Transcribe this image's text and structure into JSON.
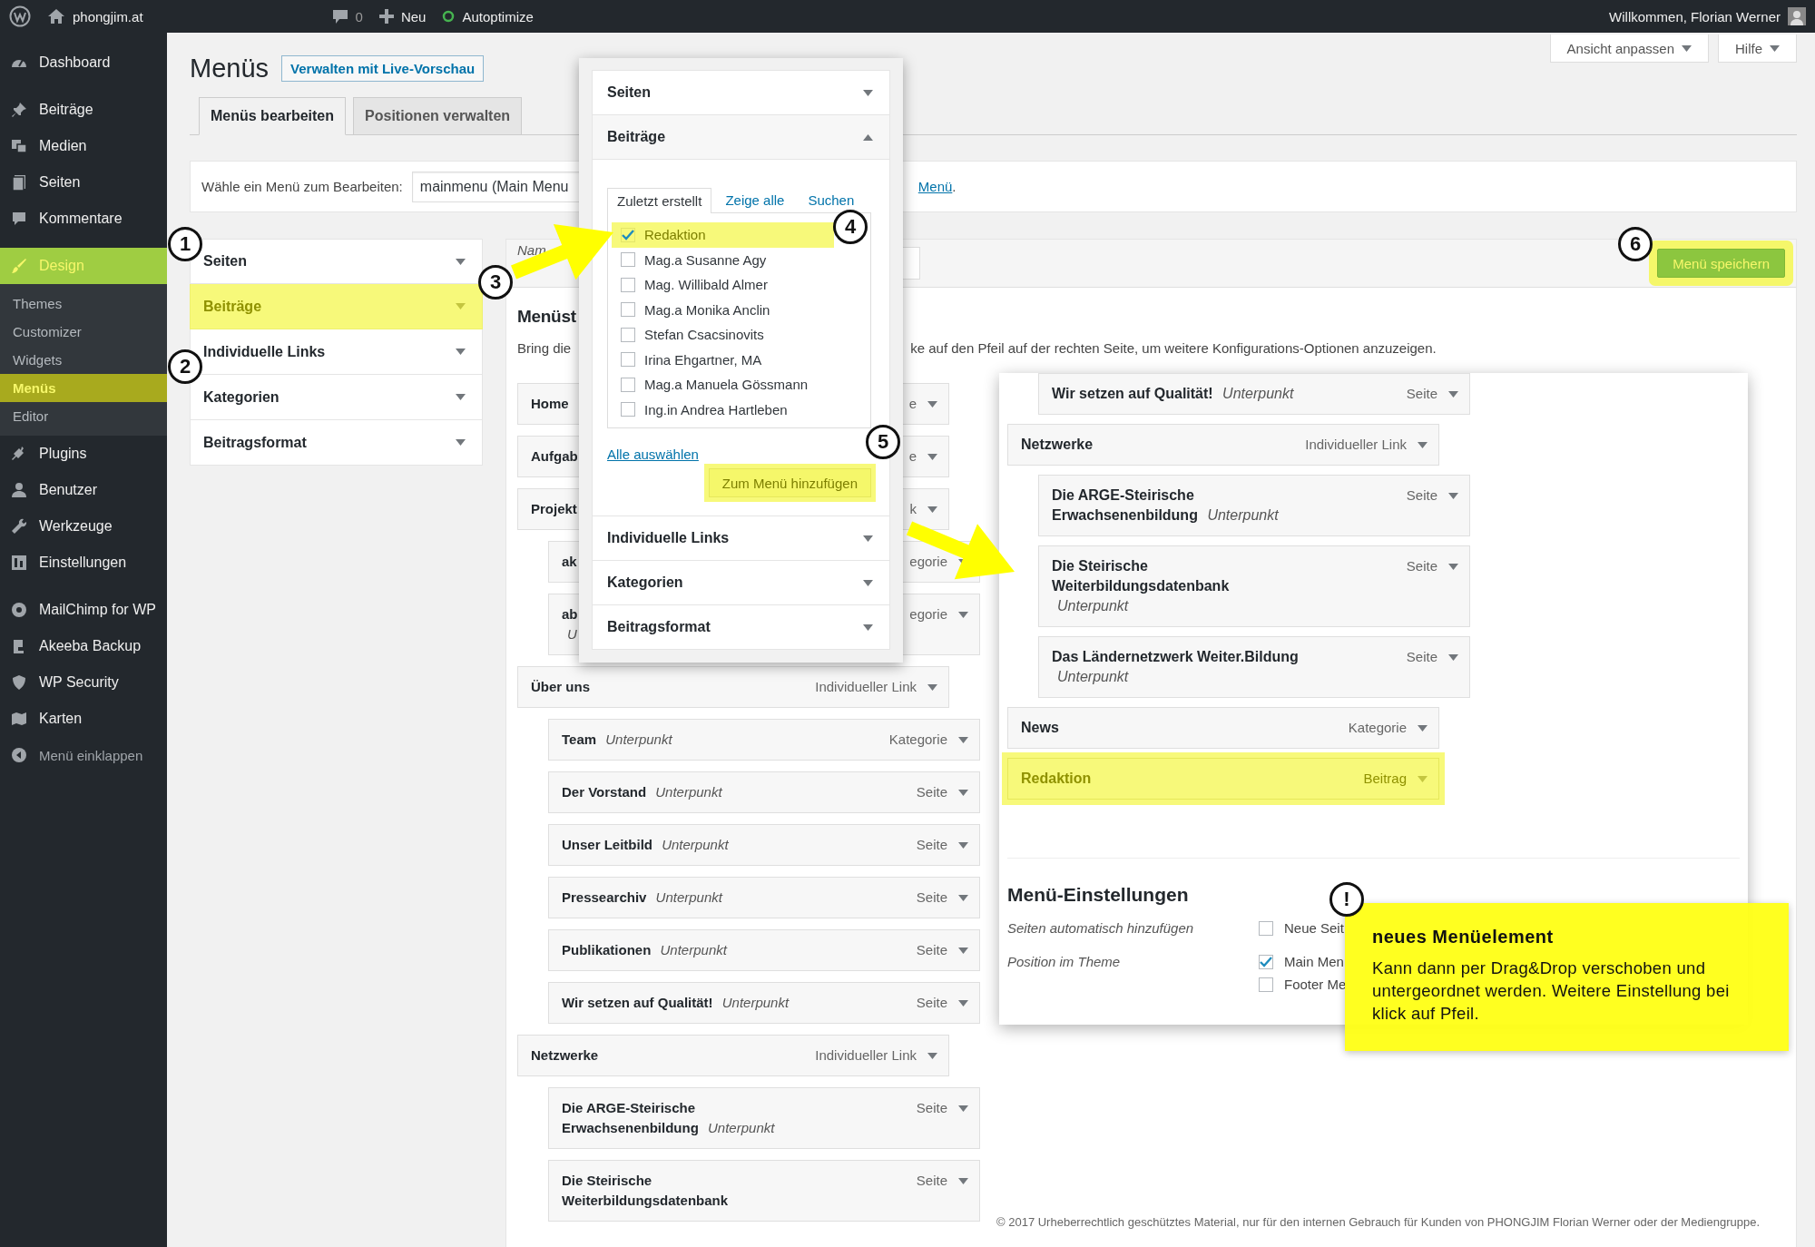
{
  "admin_bar": {
    "site": "phongjim.at",
    "comments": "0",
    "new": "Neu",
    "plugin": "Autoptimize",
    "greeting": "Willkommen, Florian Werner"
  },
  "sidebar": {
    "groups": [
      [
        {
          "label": "Dashboard",
          "kind": "dashboard",
          "selected": false
        }
      ],
      [
        {
          "label": "Beiträge",
          "kind": "pin",
          "selected": false
        },
        {
          "label": "Medien",
          "kind": "media",
          "selected": false
        },
        {
          "label": "Seiten",
          "kind": "pages",
          "selected": false
        },
        {
          "label": "Kommentare",
          "kind": "comment",
          "selected": false
        }
      ],
      [
        {
          "label": "Design",
          "kind": "brush",
          "selected": true,
          "children": [
            {
              "label": "Themes",
              "selected": false
            },
            {
              "label": "Customizer",
              "selected": false
            },
            {
              "label": "Widgets",
              "selected": false
            },
            {
              "label": "Menüs",
              "selected": true
            },
            {
              "label": "Editor",
              "selected": false
            }
          ]
        },
        {
          "label": "Plugins",
          "kind": "plug",
          "selected": false
        },
        {
          "label": "Benutzer",
          "kind": "user",
          "selected": false
        },
        {
          "label": "Werkzeuge",
          "kind": "wrench",
          "selected": false
        },
        {
          "label": "Einstellungen",
          "kind": "settings",
          "selected": false
        }
      ],
      [
        {
          "label": "MailChimp for WP",
          "kind": "mailchimp",
          "selected": false
        },
        {
          "label": "Akeeba Backup",
          "kind": "backup",
          "selected": false
        },
        {
          "label": "WP Security",
          "kind": "shield",
          "selected": false
        },
        {
          "label": "Karten",
          "kind": "map",
          "selected": false
        },
        {
          "label": "Menü einklappen",
          "kind": "collapse",
          "selected": false
        }
      ]
    ]
  },
  "header": {
    "title": "Menüs",
    "live_button": "Verwalten mit Live-Vorschau",
    "screen_options": "Ansicht anpassen",
    "help": "Hilfe"
  },
  "tabs": [
    {
      "label": "Menüs bearbeiten",
      "selected": true
    },
    {
      "label": "Positionen verwalten",
      "selected": false
    }
  ],
  "menu_select": {
    "label": "Wähle ein Menü zum Bearbeiten:",
    "value": "mainmenu (Main Menu",
    "link": "Menü",
    "link_tail": "."
  },
  "add_items": {
    "sections": [
      {
        "label": "Seiten",
        "highlighted": false
      },
      {
        "label": "Beiträge",
        "highlighted": true
      },
      {
        "label": "Individuelle Links",
        "highlighted": false
      },
      {
        "label": "Kategorien",
        "highlighted": false
      },
      {
        "label": "Beitragsformat",
        "highlighted": false
      }
    ]
  },
  "menu_editor": {
    "name_label": "Nam",
    "save_button": {
      "label": "Menü speichern",
      "highlighted": true
    },
    "heading": "Menüst",
    "intro_start": "Bring die",
    "intro_end": "ke auf den Pfeil auf der rechten Seite, um weitere Konfigurations-Optionen anzuzeigen.",
    "items": [
      {
        "name": "Home",
        "type": "e"
      },
      {
        "name": "Aufgab",
        "type": "e"
      },
      {
        "name": "Projekt",
        "type": "k",
        "children": [
          {
            "name": "ak",
            "type": "egorie"
          },
          {
            "name": "ab",
            "sub": "U",
            "type": "egorie"
          }
        ]
      },
      {
        "name": "Über uns",
        "type": "Individueller Link",
        "children": [
          {
            "name": "Team",
            "sub": "Unterpunkt",
            "type": "Kategorie"
          },
          {
            "name": "Der Vorstand",
            "sub": "Unterpunkt",
            "type": "Seite"
          },
          {
            "name": "Unser Leitbild",
            "sub": "Unterpunkt",
            "type": "Seite"
          },
          {
            "name": "Pressearchiv",
            "sub": "Unterpunkt",
            "type": "Seite"
          },
          {
            "name": "Publikationen",
            "sub": "Unterpunkt",
            "type": "Seite"
          },
          {
            "name": "Wir setzen auf Qualität!",
            "sub": "Unterpunkt",
            "type": "Seite"
          }
        ]
      },
      {
        "name": "Netzwerke",
        "type": "Individueller Link",
        "children": [
          {
            "name": "Die ARGE-Steirische Erwachsenenbildung",
            "sub": "Unterpunkt",
            "type": "Seite"
          },
          {
            "name": "Die Steirische Weiterbildungsdatenbank",
            "type": "Seite"
          }
        ]
      }
    ]
  },
  "popup": {
    "sections": [
      {
        "label": "Seiten",
        "expanded": false
      },
      {
        "label": "Beiträge",
        "expanded": true,
        "tabs": [
          {
            "label": "Zuletzt erstellt",
            "selected": true
          },
          {
            "label": "Zeige alle",
            "selected": false
          },
          {
            "label": "Suchen",
            "selected": false
          }
        ],
        "posts": [
          {
            "label": "Redaktion",
            "checked": true,
            "highlighted": true
          },
          {
            "label": "Mag.a Susanne Agy",
            "checked": false,
            "highlighted": false
          },
          {
            "label": "Mag. Willibald Almer",
            "checked": false,
            "highlighted": false
          },
          {
            "label": "Mag.a Monika Anclin",
            "checked": false,
            "highlighted": false
          },
          {
            "label": "Stefan Csacsinovits",
            "checked": false,
            "highlighted": false
          },
          {
            "label": "Irina Ehgartner, MA",
            "checked": false,
            "highlighted": false
          },
          {
            "label": "Mag.a Manuela Gössmann",
            "checked": false,
            "highlighted": false
          },
          {
            "label": "Ing.in Andrea Hartleben",
            "checked": false,
            "highlighted": false
          }
        ],
        "select_all": "Alle auswählen",
        "add_button": {
          "label": "Zum Menü hinzufügen",
          "highlighted": true
        }
      },
      {
        "label": "Individuelle Links",
        "expanded": false
      },
      {
        "label": "Kategorien",
        "expanded": false
      },
      {
        "label": "Beitragsformat",
        "expanded": false
      }
    ]
  },
  "detail": {
    "items": [
      {
        "children": [
          {
            "name": "Wir setzen auf Qualität!",
            "sub": "Unterpunkt",
            "type": "Seite",
            "highlighted": false
          }
        ]
      },
      {
        "name": "Netzwerke",
        "type": "Individueller Link",
        "highlighted": false,
        "children": [
          {
            "name": "Die ARGE-Steirische Erwachsenenbildung",
            "sub": "Unterpunkt",
            "type": "Seite",
            "highlighted": false
          },
          {
            "name": "Die Steirische Weiterbildungsdatenbank",
            "sub": "Unterpunkt",
            "type": "Seite",
            "highlighted": false
          },
          {
            "name": "Das Ländernetzwerk Weiter.Bildung",
            "sub": "Unterpunkt",
            "type": "Seite",
            "highlighted": false
          }
        ]
      },
      {
        "name": "News",
        "type": "Kategorie",
        "highlighted": false
      },
      {
        "name": "Redaktion",
        "type": "Beitrag",
        "highlighted": true
      }
    ],
    "settings": {
      "heading": "Menü-Einstellungen",
      "auto_label": "Seiten automatisch hinzufügen",
      "auto_options": [
        {
          "label": "Neue Seit",
          "checked": false
        }
      ],
      "position_label": "Position im Theme",
      "locations": [
        {
          "label": "Main Men",
          "checked": true
        },
        {
          "label": "Footer Me",
          "checked": false
        }
      ]
    }
  },
  "callout": {
    "marker": "!",
    "title": "neues Menüelement",
    "body": "Kann dann per Drag&Drop verschoben und untergeordnet werden. Weitere Einstellung bei klick auf Pfeil."
  },
  "markers": [
    "1",
    "2",
    "3",
    "4",
    "5",
    "6"
  ],
  "footer": "© 2017 Urheberrechtlich geschütztes Material, nur für den internen Gebrauch für Kunden von PHONGJIM Florian Werner oder der Mediengruppe."
}
